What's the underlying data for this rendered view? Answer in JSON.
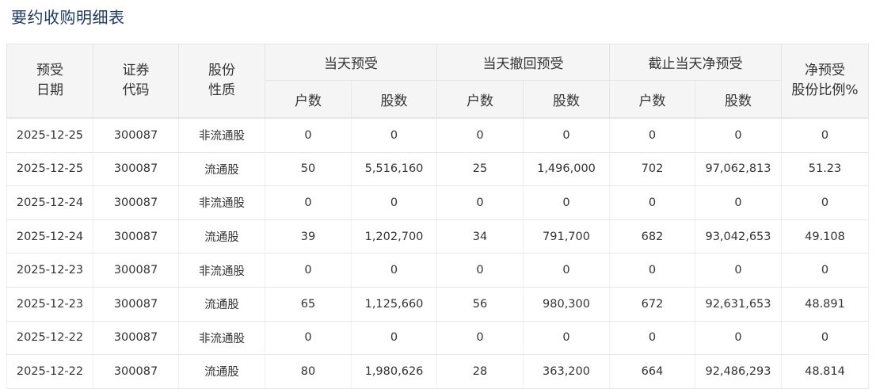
{
  "page": {
    "title": "要约收购明细表"
  },
  "table": {
    "headers": {
      "date": [
        "预受",
        "日期"
      ],
      "code": [
        "证券",
        "代码"
      ],
      "type": [
        "股份",
        "性质"
      ],
      "group_today": "当天预受",
      "group_withdraw": "当天撤回预受",
      "group_net": "截止当天净预受",
      "pct": [
        "净预受",
        "股份比例%"
      ],
      "households": "户数",
      "shares": "股数"
    },
    "rows": [
      [
        "2025-12-25",
        "300087",
        "非流通股",
        "0",
        "0",
        "0",
        "0",
        "0",
        "0",
        "0"
      ],
      [
        "2025-12-25",
        "300087",
        "流通股",
        "50",
        "5,516,160",
        "25",
        "1,496,000",
        "702",
        "97,062,813",
        "51.23"
      ],
      [
        "2025-12-24",
        "300087",
        "非流通股",
        "0",
        "0",
        "0",
        "0",
        "0",
        "0",
        "0"
      ],
      [
        "2025-12-24",
        "300087",
        "流通股",
        "39",
        "1,202,700",
        "34",
        "791,700",
        "682",
        "93,042,653",
        "49.108"
      ],
      [
        "2025-12-23",
        "300087",
        "非流通股",
        "0",
        "0",
        "0",
        "0",
        "0",
        "0",
        "0"
      ],
      [
        "2025-12-23",
        "300087",
        "流通股",
        "65",
        "1,125,660",
        "56",
        "980,300",
        "672",
        "92,631,653",
        "48.891"
      ],
      [
        "2025-12-22",
        "300087",
        "非流通股",
        "0",
        "0",
        "0",
        "0",
        "0",
        "0",
        "0"
      ],
      [
        "2025-12-22",
        "300087",
        "流通股",
        "80",
        "1,980,626",
        "28",
        "363,200",
        "664",
        "92,486,293",
        "48.814"
      ]
    ]
  }
}
